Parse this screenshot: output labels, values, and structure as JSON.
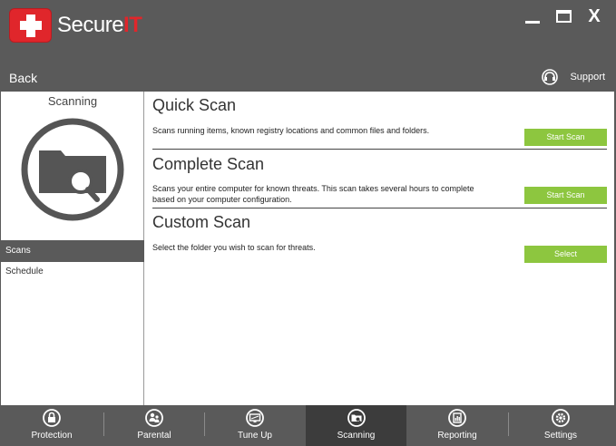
{
  "header": {
    "brand_secure": "Secure",
    "brand_it": "IT",
    "minimize": "_",
    "maximize": "□",
    "close": "X"
  },
  "toolbar": {
    "back_label": "Back",
    "support_label": "Support"
  },
  "sidebar": {
    "title": "Scanning",
    "items": [
      {
        "label": "Scans",
        "active": true
      },
      {
        "label": "Schedule",
        "active": false
      }
    ]
  },
  "sections": [
    {
      "title": "Quick Scan",
      "description": "Scans running items, known registry locations and common files and folders.",
      "button": "Start Scan"
    },
    {
      "title": "Complete Scan",
      "description": "Scans your entire computer for known threats. This scan takes several hours to complete based on your computer configuration.",
      "button": "Start Scan"
    },
    {
      "title": "Custom Scan",
      "description": "Select the folder you wish to scan for threats.",
      "button": "Select"
    }
  ],
  "nav": {
    "items": [
      {
        "label": "Protection",
        "icon": "lock-icon"
      },
      {
        "label": "Parental",
        "icon": "parental-icon"
      },
      {
        "label": "Tune Up",
        "icon": "monitor-icon"
      },
      {
        "label": "Scanning",
        "icon": "scan-folder-icon",
        "active": true
      },
      {
        "label": "Reporting",
        "icon": "report-icon"
      },
      {
        "label": "Settings",
        "icon": "gear-icon"
      }
    ]
  },
  "colors": {
    "brand_red": "#e0262b",
    "accent_green": "#8dc63f",
    "chrome_gray": "#5a5a5a",
    "active_nav": "#3c3c3c"
  }
}
